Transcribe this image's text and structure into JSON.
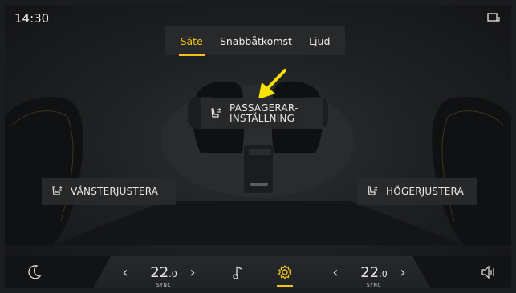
{
  "status_bar": {
    "time": "14:30",
    "right_icon": "display-mode-icon"
  },
  "tabs": [
    {
      "label": "Säte",
      "active": true
    },
    {
      "label": "Snabbåtkomst",
      "active": false
    },
    {
      "label": "Ljud",
      "active": false
    }
  ],
  "seat_buttons": {
    "passenger": {
      "line1": "PASSAGERAR-",
      "line2": "INSTÄLLNING",
      "icon": "seat-adjust-icon"
    },
    "left": {
      "label": "VÄNSTERJUSTERA",
      "icon": "seat-adjust-icon"
    },
    "right": {
      "label": "HÖGERJUSTERA",
      "icon": "seat-adjust-icon"
    }
  },
  "bottom_bar": {
    "left_icon": "moon-icon",
    "left_temp": {
      "value": "22",
      "decimal": ".0",
      "sync_label": "SYNC"
    },
    "media_icon": "music-note-icon",
    "settings_icon": "gear-icon",
    "right_temp": {
      "value": "22",
      "decimal": ".0",
      "sync_label": "SYNC"
    },
    "volume_icon": "speaker-icon"
  },
  "colors": {
    "accent": "#f2c21a",
    "annotation_arrow": "#f5e400",
    "panel": "#27292b"
  }
}
